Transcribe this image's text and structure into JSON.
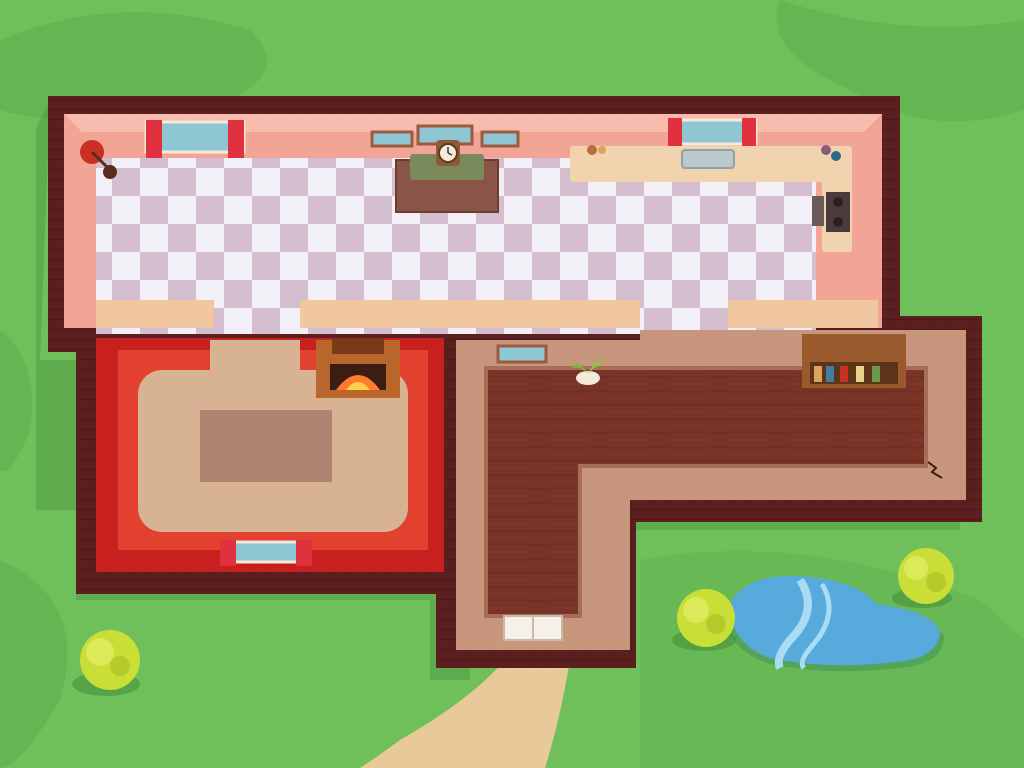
{
  "scene": {
    "type": "top-down house floor plan",
    "colors": {
      "grass": "#6fbf5b",
      "grass_dark": "#65b452",
      "outer_wall": "#5a1f1e",
      "kitchen_wall": "#f2a596",
      "kitchen_floor_light": "#f1eef5",
      "kitchen_floor_dark": "#cdb4c8",
      "living_wall": "#d63b2f",
      "living_floor": "#d8b393",
      "hall_wall": "#c8967c",
      "hall_floor": "#7a3427",
      "counter": "#f1d3ae",
      "pond": "#58a9dc",
      "pond_stripe": "#a9dcf2",
      "bush": "#c9de37",
      "path": "#e8c99a",
      "curtain": "#e0313f",
      "window_glass": "#8fc6d3"
    },
    "rooms": [
      {
        "id": "kitchen",
        "floor": "checkered"
      },
      {
        "id": "living-room",
        "floor": "carpet"
      },
      {
        "id": "hallway",
        "floor": "wood"
      }
    ],
    "objects": [
      {
        "id": "floor-lamp",
        "icon": "lamp-icon"
      },
      {
        "id": "mantel-clock",
        "icon": "clock-icon"
      },
      {
        "id": "kitchen-counter",
        "icon": "counter-icon"
      },
      {
        "id": "kitchen-sink",
        "icon": "sink-icon"
      },
      {
        "id": "stove",
        "icon": "stove-icon"
      },
      {
        "id": "fireplace",
        "icon": "fireplace-icon"
      },
      {
        "id": "rug",
        "icon": "rug-icon"
      },
      {
        "id": "potted-plant",
        "icon": "plant-icon"
      },
      {
        "id": "bookshelf",
        "icon": "bookshelf-icon"
      },
      {
        "id": "front-door",
        "icon": "door-icon"
      },
      {
        "id": "pond",
        "icon": "pond-icon"
      },
      {
        "id": "bush",
        "icon": "bush-icon",
        "count": 3
      },
      {
        "id": "dirt-path",
        "icon": "path-icon"
      }
    ]
  }
}
